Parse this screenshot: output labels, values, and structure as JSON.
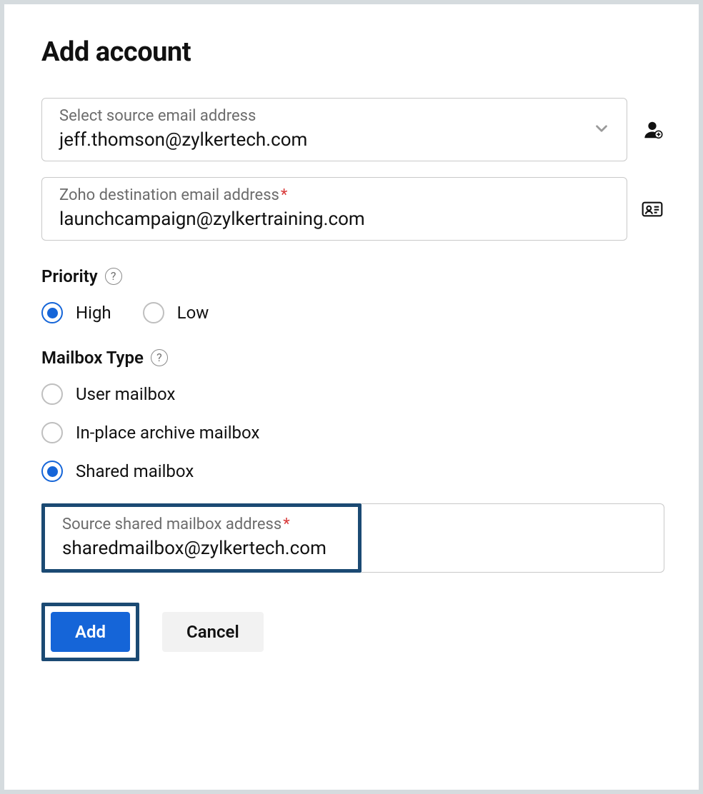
{
  "title": "Add account",
  "sourceEmail": {
    "label": "Select source email address",
    "value": "jeff.thomson@zylkertech.com"
  },
  "destEmail": {
    "label": "Zoho destination email address",
    "required": "*",
    "value": "launchcampaign@zylkertraining.com"
  },
  "priority": {
    "title": "Priority",
    "options": {
      "high": "High",
      "low": "Low"
    },
    "selected": "high"
  },
  "mailboxType": {
    "title": "Mailbox Type",
    "options": {
      "user": "User mailbox",
      "archive": "In-place archive mailbox",
      "shared": "Shared mailbox"
    },
    "selected": "shared"
  },
  "sharedMailbox": {
    "label": "Source shared mailbox address",
    "required": "*",
    "value": "sharedmailbox@zylkertech.com"
  },
  "buttons": {
    "add": "Add",
    "cancel": "Cancel"
  },
  "helpGlyph": "?"
}
